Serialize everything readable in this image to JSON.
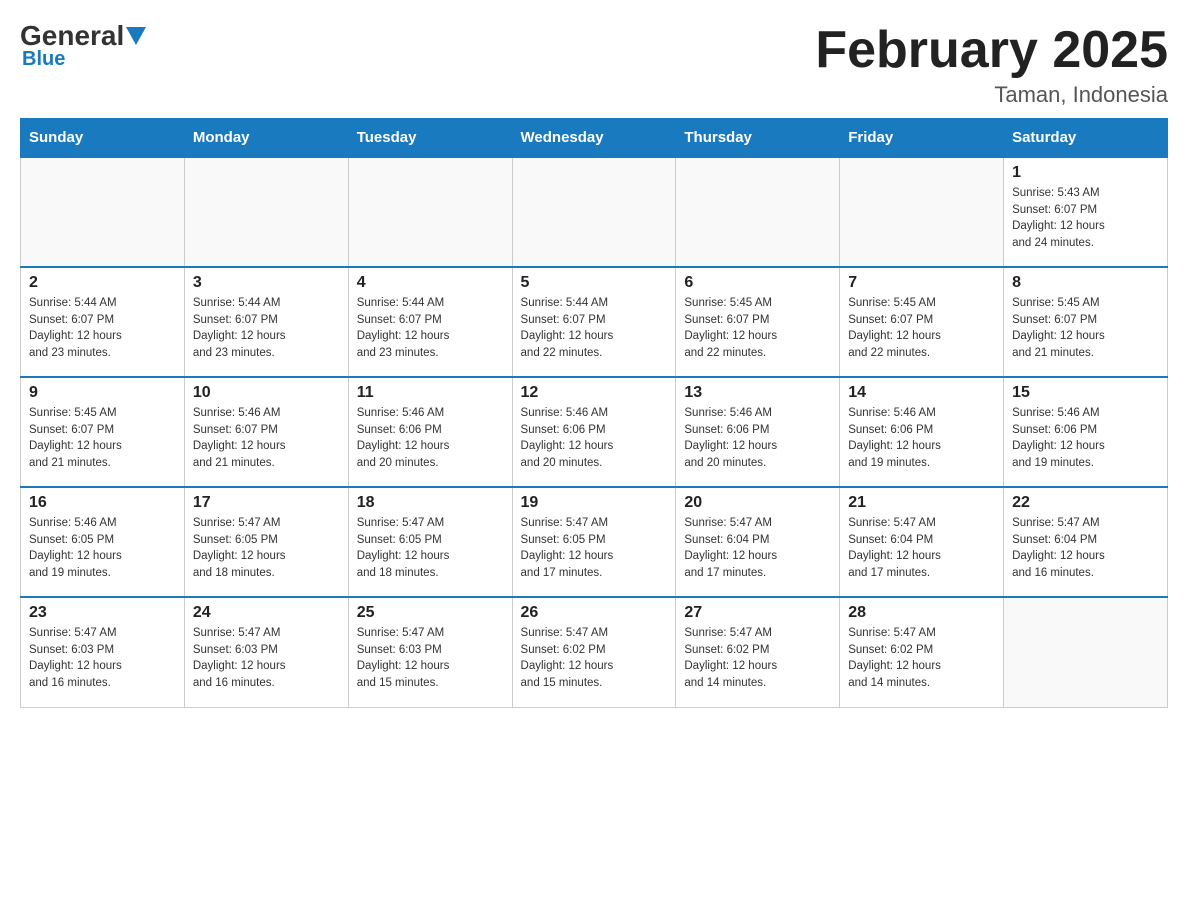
{
  "logo": {
    "general": "General",
    "blue": "Blue"
  },
  "header": {
    "month": "February 2025",
    "location": "Taman, Indonesia"
  },
  "weekdays": [
    "Sunday",
    "Monday",
    "Tuesday",
    "Wednesday",
    "Thursday",
    "Friday",
    "Saturday"
  ],
  "weeks": [
    [
      {
        "day": "",
        "info": ""
      },
      {
        "day": "",
        "info": ""
      },
      {
        "day": "",
        "info": ""
      },
      {
        "day": "",
        "info": ""
      },
      {
        "day": "",
        "info": ""
      },
      {
        "day": "",
        "info": ""
      },
      {
        "day": "1",
        "info": "Sunrise: 5:43 AM\nSunset: 6:07 PM\nDaylight: 12 hours\nand 24 minutes."
      }
    ],
    [
      {
        "day": "2",
        "info": "Sunrise: 5:44 AM\nSunset: 6:07 PM\nDaylight: 12 hours\nand 23 minutes."
      },
      {
        "day": "3",
        "info": "Sunrise: 5:44 AM\nSunset: 6:07 PM\nDaylight: 12 hours\nand 23 minutes."
      },
      {
        "day": "4",
        "info": "Sunrise: 5:44 AM\nSunset: 6:07 PM\nDaylight: 12 hours\nand 23 minutes."
      },
      {
        "day": "5",
        "info": "Sunrise: 5:44 AM\nSunset: 6:07 PM\nDaylight: 12 hours\nand 22 minutes."
      },
      {
        "day": "6",
        "info": "Sunrise: 5:45 AM\nSunset: 6:07 PM\nDaylight: 12 hours\nand 22 minutes."
      },
      {
        "day": "7",
        "info": "Sunrise: 5:45 AM\nSunset: 6:07 PM\nDaylight: 12 hours\nand 22 minutes."
      },
      {
        "day": "8",
        "info": "Sunrise: 5:45 AM\nSunset: 6:07 PM\nDaylight: 12 hours\nand 21 minutes."
      }
    ],
    [
      {
        "day": "9",
        "info": "Sunrise: 5:45 AM\nSunset: 6:07 PM\nDaylight: 12 hours\nand 21 minutes."
      },
      {
        "day": "10",
        "info": "Sunrise: 5:46 AM\nSunset: 6:07 PM\nDaylight: 12 hours\nand 21 minutes."
      },
      {
        "day": "11",
        "info": "Sunrise: 5:46 AM\nSunset: 6:06 PM\nDaylight: 12 hours\nand 20 minutes."
      },
      {
        "day": "12",
        "info": "Sunrise: 5:46 AM\nSunset: 6:06 PM\nDaylight: 12 hours\nand 20 minutes."
      },
      {
        "day": "13",
        "info": "Sunrise: 5:46 AM\nSunset: 6:06 PM\nDaylight: 12 hours\nand 20 minutes."
      },
      {
        "day": "14",
        "info": "Sunrise: 5:46 AM\nSunset: 6:06 PM\nDaylight: 12 hours\nand 19 minutes."
      },
      {
        "day": "15",
        "info": "Sunrise: 5:46 AM\nSunset: 6:06 PM\nDaylight: 12 hours\nand 19 minutes."
      }
    ],
    [
      {
        "day": "16",
        "info": "Sunrise: 5:46 AM\nSunset: 6:05 PM\nDaylight: 12 hours\nand 19 minutes."
      },
      {
        "day": "17",
        "info": "Sunrise: 5:47 AM\nSunset: 6:05 PM\nDaylight: 12 hours\nand 18 minutes."
      },
      {
        "day": "18",
        "info": "Sunrise: 5:47 AM\nSunset: 6:05 PM\nDaylight: 12 hours\nand 18 minutes."
      },
      {
        "day": "19",
        "info": "Sunrise: 5:47 AM\nSunset: 6:05 PM\nDaylight: 12 hours\nand 17 minutes."
      },
      {
        "day": "20",
        "info": "Sunrise: 5:47 AM\nSunset: 6:04 PM\nDaylight: 12 hours\nand 17 minutes."
      },
      {
        "day": "21",
        "info": "Sunrise: 5:47 AM\nSunset: 6:04 PM\nDaylight: 12 hours\nand 17 minutes."
      },
      {
        "day": "22",
        "info": "Sunrise: 5:47 AM\nSunset: 6:04 PM\nDaylight: 12 hours\nand 16 minutes."
      }
    ],
    [
      {
        "day": "23",
        "info": "Sunrise: 5:47 AM\nSunset: 6:03 PM\nDaylight: 12 hours\nand 16 minutes."
      },
      {
        "day": "24",
        "info": "Sunrise: 5:47 AM\nSunset: 6:03 PM\nDaylight: 12 hours\nand 16 minutes."
      },
      {
        "day": "25",
        "info": "Sunrise: 5:47 AM\nSunset: 6:03 PM\nDaylight: 12 hours\nand 15 minutes."
      },
      {
        "day": "26",
        "info": "Sunrise: 5:47 AM\nSunset: 6:02 PM\nDaylight: 12 hours\nand 15 minutes."
      },
      {
        "day": "27",
        "info": "Sunrise: 5:47 AM\nSunset: 6:02 PM\nDaylight: 12 hours\nand 14 minutes."
      },
      {
        "day": "28",
        "info": "Sunrise: 5:47 AM\nSunset: 6:02 PM\nDaylight: 12 hours\nand 14 minutes."
      },
      {
        "day": "",
        "info": ""
      }
    ]
  ]
}
